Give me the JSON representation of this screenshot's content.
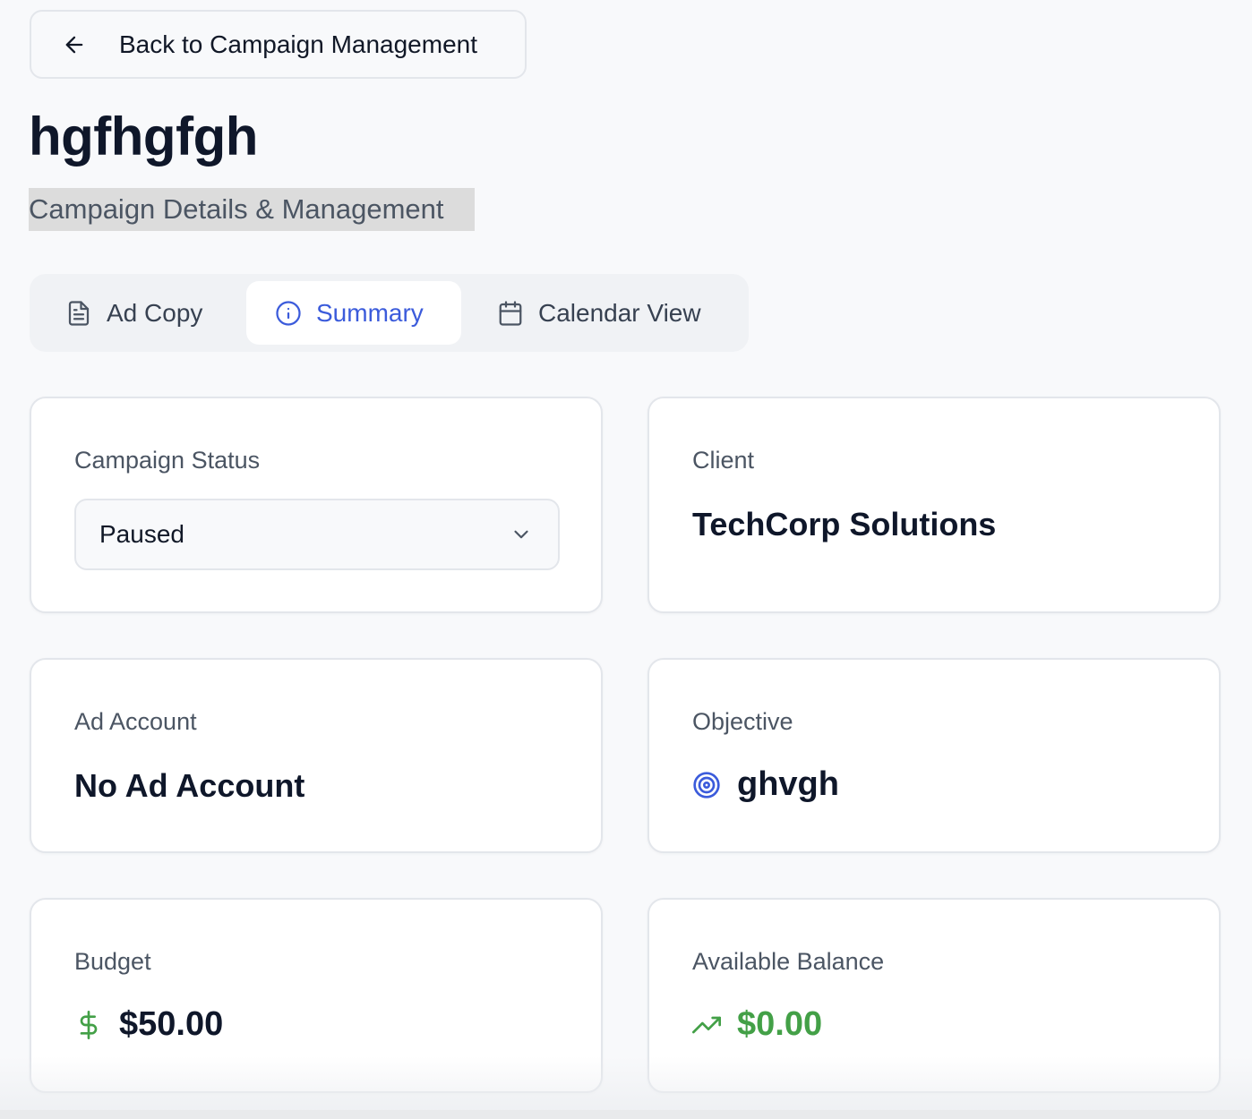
{
  "back_button": {
    "label": "Back to Campaign Management"
  },
  "page": {
    "title": "hgfhgfgh",
    "subtitle": "Campaign Details & Management"
  },
  "tabs": [
    {
      "label": "Ad Copy",
      "icon": "file-text-icon",
      "active": false
    },
    {
      "label": "Summary",
      "icon": "info-icon",
      "active": true
    },
    {
      "label": "Calendar View",
      "icon": "calendar-icon",
      "active": false
    }
  ],
  "cards": {
    "status": {
      "label": "Campaign Status",
      "value": "Paused",
      "icon": "chevron-down-icon"
    },
    "client": {
      "label": "Client",
      "value": "TechCorp Solutions"
    },
    "ad_account": {
      "label": "Ad Account",
      "value": "No Ad Account"
    },
    "objective": {
      "label": "Objective",
      "value": "ghvgh",
      "icon": "target-icon"
    },
    "budget": {
      "label": "Budget",
      "value": "$50.00",
      "icon": "dollar-icon"
    },
    "balance": {
      "label": "Available Balance",
      "value": "$0.00",
      "icon": "trending-up-icon"
    }
  },
  "colors": {
    "accent": "#3b5bdb",
    "success": "#43a047",
    "text": "#0f172a",
    "muted": "#4b5563"
  }
}
